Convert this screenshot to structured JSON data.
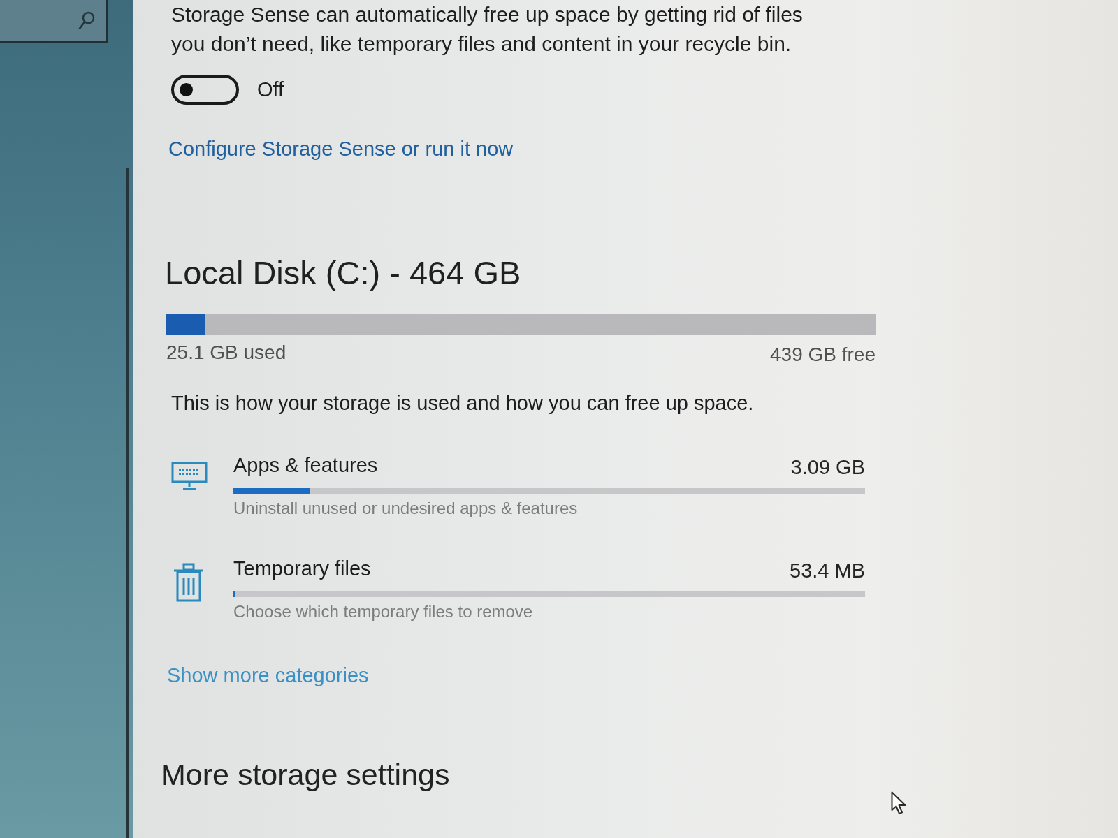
{
  "storage_sense": {
    "description": "Storage Sense can automatically free up space by getting rid of files you don’t need, like temporary files and content in your recycle bin.",
    "toggle": {
      "on": false,
      "label": "Off"
    },
    "link": "Configure Storage Sense or run it now"
  },
  "disk": {
    "title": "Local Disk (C:) - 464 GB",
    "level": 0.054,
    "used": "25.1 GB used",
    "free": "439 GB free",
    "description": "This is how your storage is used and how you can free up space.",
    "categories": [
      {
        "kind": "apps",
        "name": "Apps & features",
        "size": "3.09 GB",
        "level": 0.122,
        "hint": "Uninstall unused or undesired apps & features"
      },
      {
        "kind": "temp",
        "name": "Temporary files",
        "size": "53.4 MB",
        "level": 0.003,
        "hint": "Choose which temporary files to remove"
      }
    ],
    "more_link": "Show more categories"
  },
  "more_settings": {
    "title": "More storage settings"
  }
}
